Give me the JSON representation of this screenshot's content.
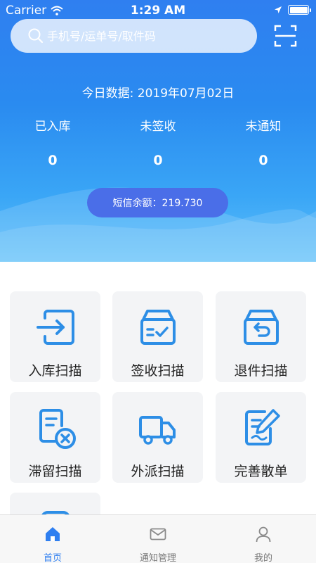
{
  "status_bar": {
    "carrier": "Carrier",
    "time": "1:29 AM",
    "battery_level": 1.0
  },
  "search": {
    "placeholder": "手机号/运单号/取件码",
    "icon": "search-icon",
    "scan_icon": "scan-icon"
  },
  "summary": {
    "today": "今日数据: 2019年07月02日",
    "stats": [
      {
        "label": "已入库",
        "value": "0"
      },
      {
        "label": "未签收",
        "value": "0"
      },
      {
        "label": "未通知",
        "value": "0"
      }
    ],
    "sms_balance": "短信余额：219.730"
  },
  "actions": [
    {
      "label": "入库扫描",
      "icon": "stock-in-icon"
    },
    {
      "label": "签收扫描",
      "icon": "sign-box-icon"
    },
    {
      "label": "退件扫描",
      "icon": "return-box-icon"
    },
    {
      "label": "滞留扫描",
      "icon": "retention-doc-icon"
    },
    {
      "label": "外派扫描",
      "icon": "delivery-truck-icon"
    },
    {
      "label": "完善散单",
      "icon": "edit-doc-icon"
    }
  ],
  "tabs": [
    {
      "label": "首页",
      "icon": "home-icon",
      "active": true
    },
    {
      "label": "通知管理",
      "icon": "mail-icon",
      "active": false
    },
    {
      "label": "我的",
      "icon": "user-icon",
      "active": false
    }
  ],
  "colors": {
    "accent": "#2f7ff0",
    "icon_blue": "#2d8ee6",
    "sms_pill": "#4a6ee8"
  }
}
